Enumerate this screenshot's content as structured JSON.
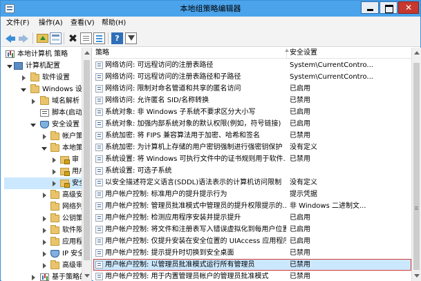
{
  "window": {
    "title": "本地组策略编辑器",
    "close_glyph": "✕"
  },
  "menu": {
    "file": "文件(F)",
    "action": "操作(A)",
    "view": "查看(V)",
    "help": "帮助(H)"
  },
  "toolbar": {
    "delete_glyph": "✖",
    "help_glyph": "?"
  },
  "tree": {
    "items": [
      {
        "label": "本地计算机 策略",
        "icon": "chart-icon"
      },
      {
        "label": "计算机配置",
        "icon": "computer-icon"
      },
      {
        "label": "软件设置",
        "icon": "folder-icon"
      },
      {
        "label": "Windows 设置",
        "icon": "folder-icon"
      },
      {
        "label": "域名解析",
        "icon": "folder-icon"
      },
      {
        "label": "脚本(启动/",
        "icon": "script-icon"
      },
      {
        "label": "安全设置",
        "icon": "shield-icon"
      },
      {
        "label": "帐户策",
        "icon": "folder-icon"
      },
      {
        "label": "本地策",
        "icon": "folder-icon"
      },
      {
        "label": "审",
        "icon": "folder-lock"
      },
      {
        "label": "用户",
        "icon": "folder-lock"
      },
      {
        "label": "安全",
        "icon": "folder-lock"
      },
      {
        "label": "高级安",
        "icon": "folder-icon"
      },
      {
        "label": "网络列",
        "icon": "folder-icon"
      },
      {
        "label": "公钥策",
        "icon": "folder-icon"
      },
      {
        "label": "软件限",
        "icon": "folder-icon"
      },
      {
        "label": "应用程",
        "icon": "folder-icon"
      },
      {
        "label": "IP 安全",
        "icon": "shield-icon"
      },
      {
        "label": "高级审",
        "icon": "folder-icon"
      },
      {
        "label": "基于策略的",
        "icon": "chart-icon"
      }
    ]
  },
  "list": {
    "col_policy": "策略",
    "col_setting": "安全设置",
    "rows": [
      {
        "policy": "网络访问: 可远程访问的注册表路径",
        "setting": "System\\CurrentContro..."
      },
      {
        "policy": "网络访问: 可远程访问的注册表路径和子路径",
        "setting": "System\\CurrentContro..."
      },
      {
        "policy": "网络访问: 限制对命名管道和共享的匿名访问",
        "setting": "已启用"
      },
      {
        "policy": "网络访问: 允许匿名 SID/名称转换",
        "setting": "已禁用"
      },
      {
        "policy": "系统对象: 非 Windows 子系统不要求区分大小写",
        "setting": "已启用"
      },
      {
        "policy": "系统对象: 加强内部系统对象的默认权限(例如，符号链接)",
        "setting": "已启用"
      },
      {
        "policy": "系统加密: 将 FIPS 兼容算法用于加密、哈希和签名",
        "setting": "已禁用"
      },
      {
        "policy": "系统加密: 为计算机上存储的用户密钥强制进行强密钥保护",
        "setting": "没有定义"
      },
      {
        "policy": "系统设置: 将 Windows 可执行文件中的证书规则用于软件...",
        "setting": "已禁用"
      },
      {
        "policy": "系统设置: 可选子系统",
        "setting": ""
      },
      {
        "policy": "以安全描述符定义语言(SDDL)语法表示的计算机访问限制",
        "setting": "没有定义"
      },
      {
        "policy": "用户帐户控制: 标准用户的提升提示行为",
        "setting": "提示凭据"
      },
      {
        "policy": "用户帐户控制: 管理员批准模式中管理员的提升权限提示的...",
        "setting": "非 Windows 二进制文..."
      },
      {
        "policy": "用户帐户控制: 检测应用程序安装并提示提升",
        "setting": "已启用"
      },
      {
        "policy": "用户帐户控制: 将文件和注册表写入错误虚拟化到每用户位置",
        "setting": "已启用"
      },
      {
        "policy": "用户帐户控制: 仅提升安装在安全位置的 UIAccess 应用程序",
        "setting": "已启用"
      },
      {
        "policy": "用户帐户控制: 提示提升时切换到安全桌面",
        "setting": "已禁用"
      },
      {
        "policy": "用户帐户控制: 以管理员批准模式运行所有管理员",
        "setting": "已禁用"
      },
      {
        "policy": "用户帐户控制: 用于内置管理员帐户的管理员批准模式",
        "setting": "已禁用"
      }
    ]
  }
}
